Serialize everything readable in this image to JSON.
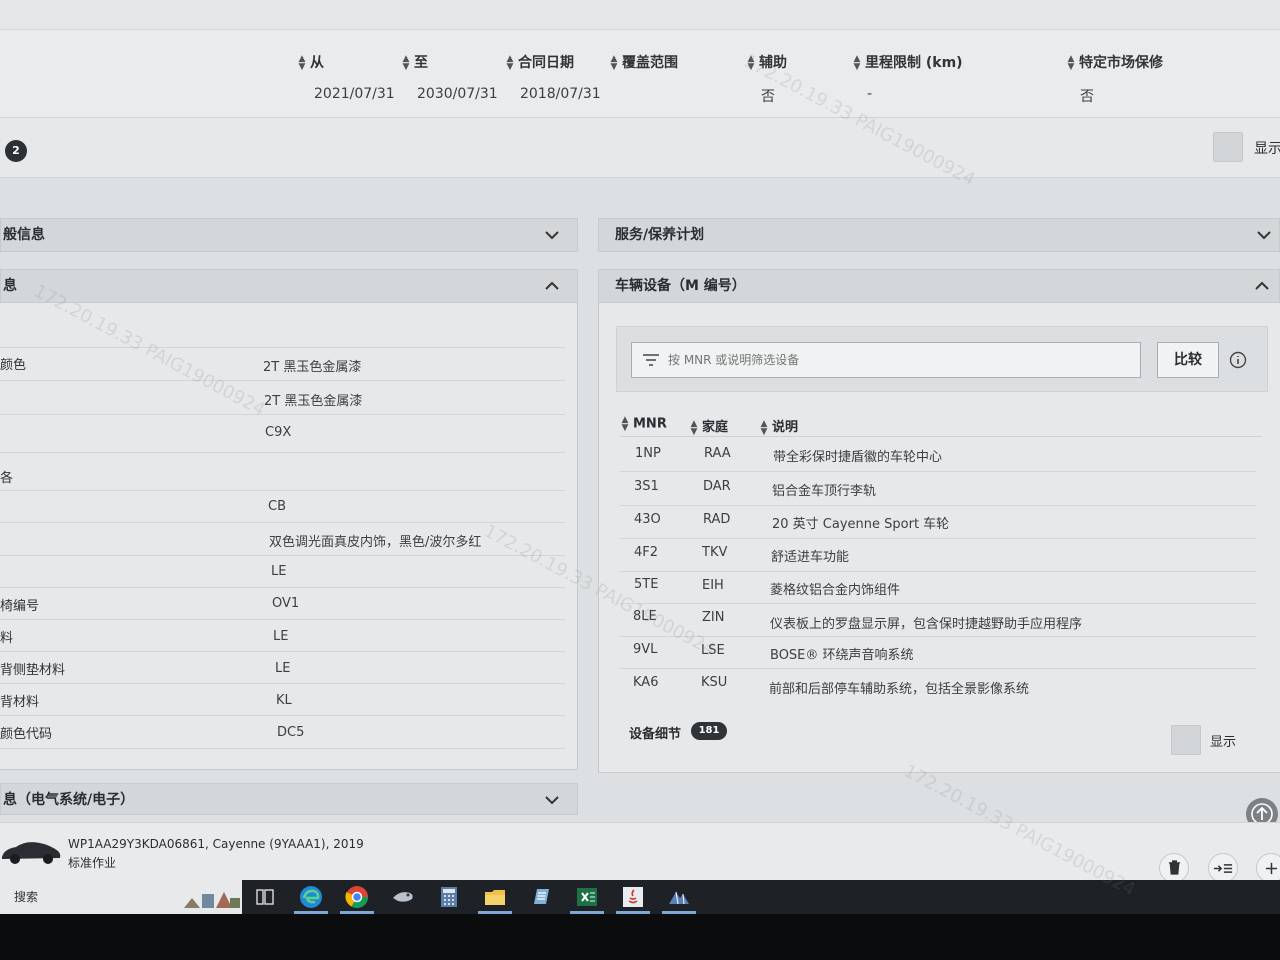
{
  "contract": {
    "headers": [
      "从",
      "至",
      "合同日期",
      "覆盖范围",
      "辅助",
      "里程限制 (km)",
      "特定市场保修"
    ],
    "values": [
      "2021/07/31",
      "2030/07/31",
      "2018/07/31",
      "",
      "否",
      "-",
      "否"
    ]
  },
  "strip": {
    "badge": "2",
    "show_label": "显示"
  },
  "left": {
    "general_info_title": "般信息",
    "info_title": "息",
    "rows": [
      {
        "label": "颜色",
        "value": "2T 黑玉色金属漆"
      },
      {
        "label": "",
        "value": "2T 黑玉色金属漆"
      },
      {
        "label": "",
        "value": "C9X"
      },
      {
        "label": "各",
        "value": ""
      },
      {
        "label": "",
        "value": "CB"
      },
      {
        "label": "",
        "value": "双色调光面真皮内饰，黑色/波尔多红"
      },
      {
        "label": "",
        "value": "LE"
      },
      {
        "label": "椅编号",
        "value": "OV1"
      },
      {
        "label": "料",
        "value": "LE"
      },
      {
        "label": "背侧垫材料",
        "value": "LE"
      },
      {
        "label": "背材料",
        "value": "KL"
      },
      {
        "label": "颜色代码",
        "value": "DC5"
      }
    ],
    "electrical_title": "息（电气系统/电子）"
  },
  "right": {
    "service_title": "服务/保养计划",
    "equipment_title": "车辆设备（M 编号）",
    "filter_placeholder": "按 MNR 或说明筛选设备",
    "compare_label": "比较",
    "columns": [
      "MNR",
      "家庭",
      "说明"
    ],
    "rows": [
      {
        "mnr": "1NP",
        "family": "RAA",
        "desc": "带全彩保时捷盾徽的车轮中心"
      },
      {
        "mnr": "3S1",
        "family": "DAR",
        "desc": "铝合金车顶行李轨"
      },
      {
        "mnr": "43O",
        "family": "RAD",
        "desc": "20 英寸 Cayenne Sport 车轮"
      },
      {
        "mnr": "4F2",
        "family": "TKV",
        "desc": "舒适进车功能"
      },
      {
        "mnr": "5TE",
        "family": "EIH",
        "desc": "菱格纹铝合金内饰组件"
      },
      {
        "mnr": "8LE",
        "family": "ZIN",
        "desc": "仪表板上的罗盘显示屏，包含保时捷越野助手应用程序"
      },
      {
        "mnr": "9VL",
        "family": "LSE",
        "desc": "BOSE® 环绕声音响系统"
      },
      {
        "mnr": "KA6",
        "family": "KSU",
        "desc": "前部和后部停车辅助系统，包括全景影像系统"
      }
    ],
    "detail_label": "设备细节",
    "detail_count": "181",
    "show_label": "显示"
  },
  "vehicle": {
    "vin_line": "WP1AA29Y3KDA06861, Cayenne (9YAAA1), 2019",
    "job_line": "标准作业"
  },
  "taskbar": {
    "search_label": "搜索"
  },
  "watermark_text": "172.20.19.33 PAIG19000924"
}
